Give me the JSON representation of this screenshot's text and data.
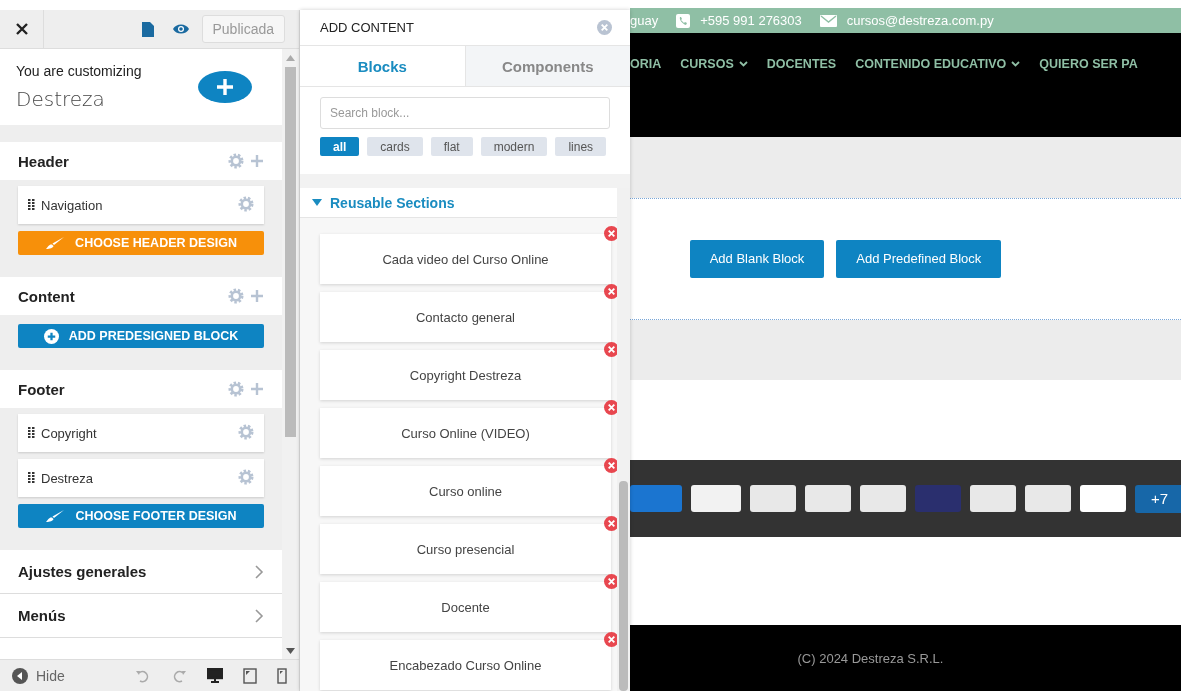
{
  "sidebar": {
    "publish_button": "Publicada",
    "customizing_label": "You are customizing",
    "site_name": "Destreza",
    "sections": [
      {
        "title": "Header",
        "items": [
          {
            "label": "Navigation"
          }
        ],
        "button": {
          "label": "CHOOSE HEADER DESIGN",
          "kind": "brush",
          "color": "#f7900a"
        }
      },
      {
        "title": "Content",
        "button": {
          "label": "ADD PREDESIGNED BLOCK",
          "kind": "plus",
          "color": "#0e84c2"
        }
      },
      {
        "title": "Footer",
        "items": [
          {
            "label": "Copyright"
          },
          {
            "label": "Destreza"
          }
        ],
        "button": {
          "label": "CHOOSE FOOTER DESIGN",
          "kind": "brush",
          "color": "#0e84c2"
        }
      }
    ],
    "links": [
      {
        "label": "Ajustes generales"
      },
      {
        "label": "Menús"
      }
    ],
    "hide_label": "Hide",
    "devices": [
      {
        "kind": "desktop",
        "selected": true
      },
      {
        "kind": "tablet",
        "selected": false
      },
      {
        "kind": "mobile",
        "selected": false
      }
    ]
  },
  "add_content": {
    "title": "ADD CONTENT",
    "tabs": [
      {
        "label": "Blocks",
        "selected": true
      },
      {
        "label": "Components",
        "selected": false
      }
    ],
    "search": {
      "placeholder": "Search block..."
    },
    "filters": [
      {
        "label": "all",
        "selected": true
      },
      {
        "label": "cards",
        "selected": false
      },
      {
        "label": "flat",
        "selected": false
      },
      {
        "label": "modern",
        "selected": false
      },
      {
        "label": "lines",
        "selected": false
      }
    ],
    "group": {
      "title": "Reusable Sections",
      "expanded": true,
      "items": [
        {
          "label": "Cada video del Curso Online"
        },
        {
          "label": "Contacto general"
        },
        {
          "label": "Copyright Destreza"
        },
        {
          "label": "Curso Online (VIDEO)"
        },
        {
          "label": "Curso online"
        },
        {
          "label": "Curso presencial"
        },
        {
          "label": "Docente"
        },
        {
          "label": "Encabezado Curso Online"
        }
      ]
    }
  },
  "preview": {
    "topbar": {
      "location": "guay",
      "phone": "+595 991 276303",
      "email": "cursos@destreza.com.py"
    },
    "nav": [
      {
        "label": "ORIA",
        "dropdown": false
      },
      {
        "label": "CURSOS",
        "dropdown": true
      },
      {
        "label": "DOCENTES",
        "dropdown": false
      },
      {
        "label": "CONTENIDO EDUCATIVO",
        "dropdown": true
      },
      {
        "label": "QUIERO SER PA",
        "dropdown": false
      }
    ],
    "buttons": [
      "Add Blank Block",
      "Add Predefined Block"
    ],
    "payments_more": "+7",
    "copyright": "(C) 2024 Destreza S.R.L."
  }
}
